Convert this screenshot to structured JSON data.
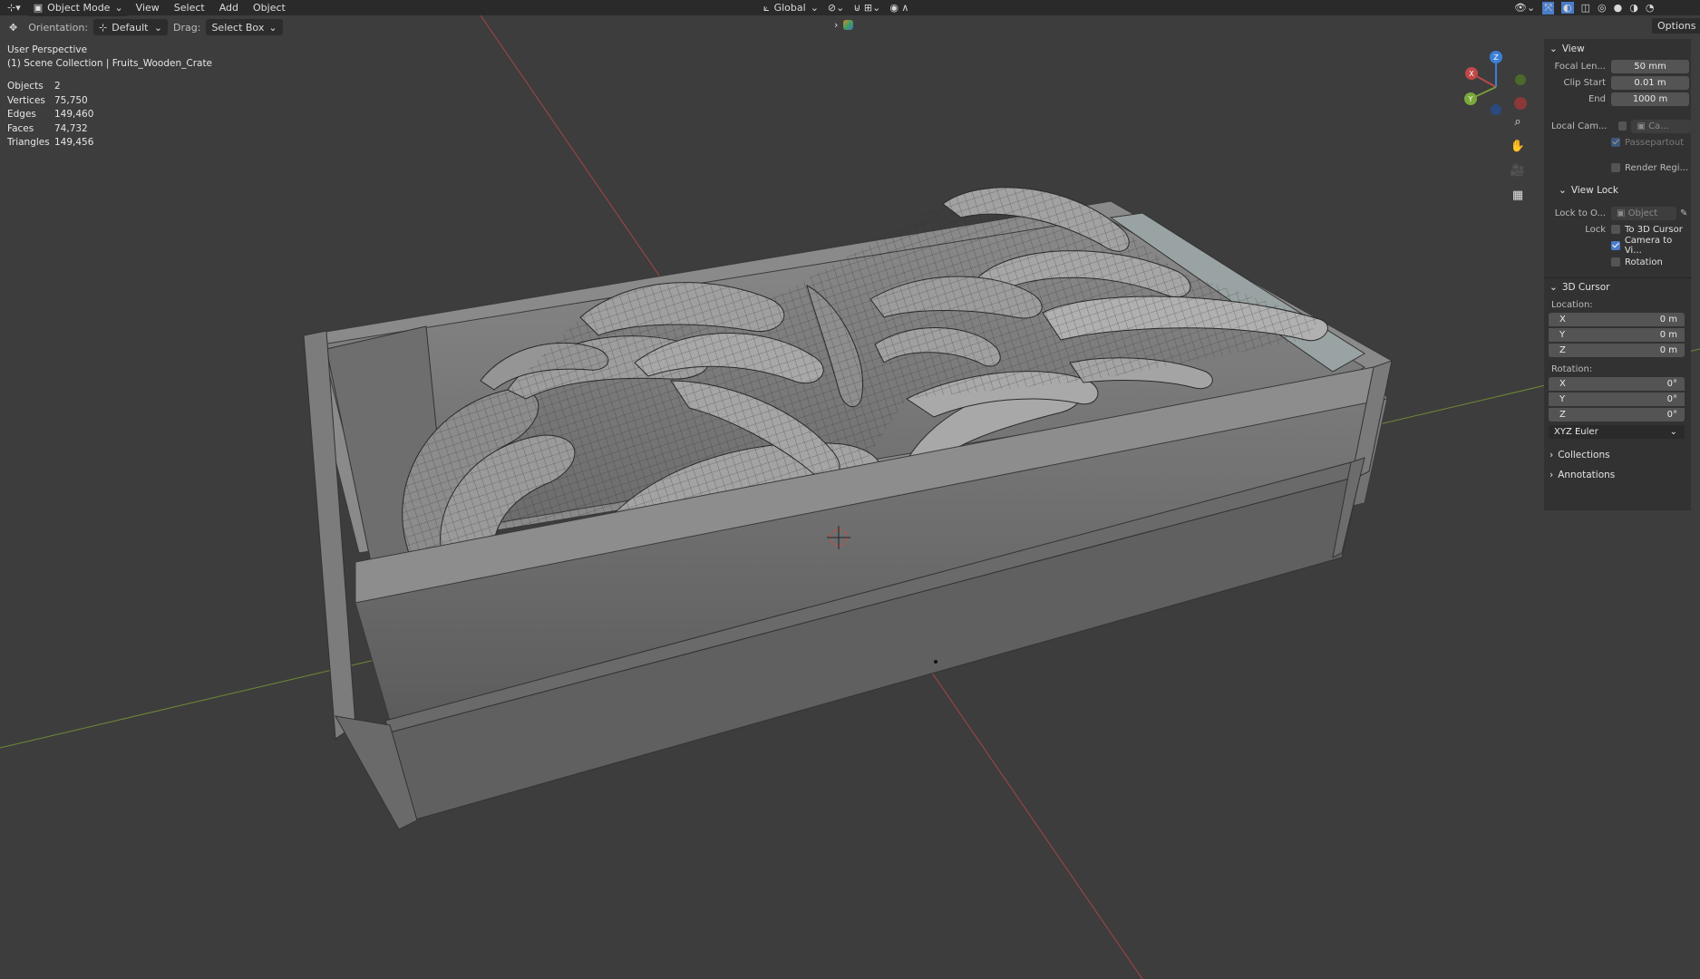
{
  "header": {
    "mode": "Object Mode",
    "menus": [
      "View",
      "Select",
      "Add",
      "Object"
    ],
    "transform_orientation": "Global",
    "options_label": "Options"
  },
  "toolbar": {
    "orientation_label": "Orientation:",
    "orientation_value": "Default",
    "drag_label": "Drag:",
    "drag_value": "Select Box"
  },
  "viewport": {
    "view_name": "User Perspective",
    "collection": "(1) Scene Collection | Fruits_Wooden_Crate",
    "stats": [
      {
        "label": "Objects",
        "value": "2"
      },
      {
        "label": "Vertices",
        "value": "75,750"
      },
      {
        "label": "Edges",
        "value": "149,460"
      },
      {
        "label": "Faces",
        "value": "74,732"
      },
      {
        "label": "Triangles",
        "value": "149,456"
      }
    ],
    "gizmo": {
      "x": "X",
      "y": "Y",
      "z": "Z"
    }
  },
  "npanel": {
    "view_section": "View",
    "focal_label": "Focal Len...",
    "focal_value": "50 mm",
    "clip_start_label": "Clip Start",
    "clip_start_value": "0.01 m",
    "end_label": "End",
    "end_value": "1000 m",
    "local_cam_label": "Local Cam...",
    "local_cam_value": "Ca...",
    "passepartout": "Passepartout",
    "render_region": "Render Regi...",
    "view_lock_section": "View Lock",
    "lock_to_label": "Lock to O...",
    "lock_to_value": "Object",
    "lock_label": "Lock",
    "to_3d_cursor": "To 3D Cursor",
    "camera_to_view": "Camera to Vi...",
    "rotation_chk": "Rotation",
    "cursor_section": "3D Cursor",
    "location_label": "Location:",
    "location": [
      {
        "axis": "X",
        "value": "0 m"
      },
      {
        "axis": "Y",
        "value": "0 m"
      },
      {
        "axis": "Z",
        "value": "0 m"
      }
    ],
    "rotation_label": "Rotation:",
    "rotation": [
      {
        "axis": "X",
        "value": "0°"
      },
      {
        "axis": "Y",
        "value": "0°"
      },
      {
        "axis": "Z",
        "value": "0°"
      }
    ],
    "rotation_mode": "XYZ Euler",
    "collections_section": "Collections",
    "annotations_section": "Annotations"
  },
  "colors": {
    "viewport_bg": "#3d3d3d",
    "header_bg": "#2a2a2a",
    "x_axis": "#b84848",
    "y_axis": "#7a9a3a",
    "z_axis": "#3c7fd8",
    "accent": "#4a7cc8"
  }
}
